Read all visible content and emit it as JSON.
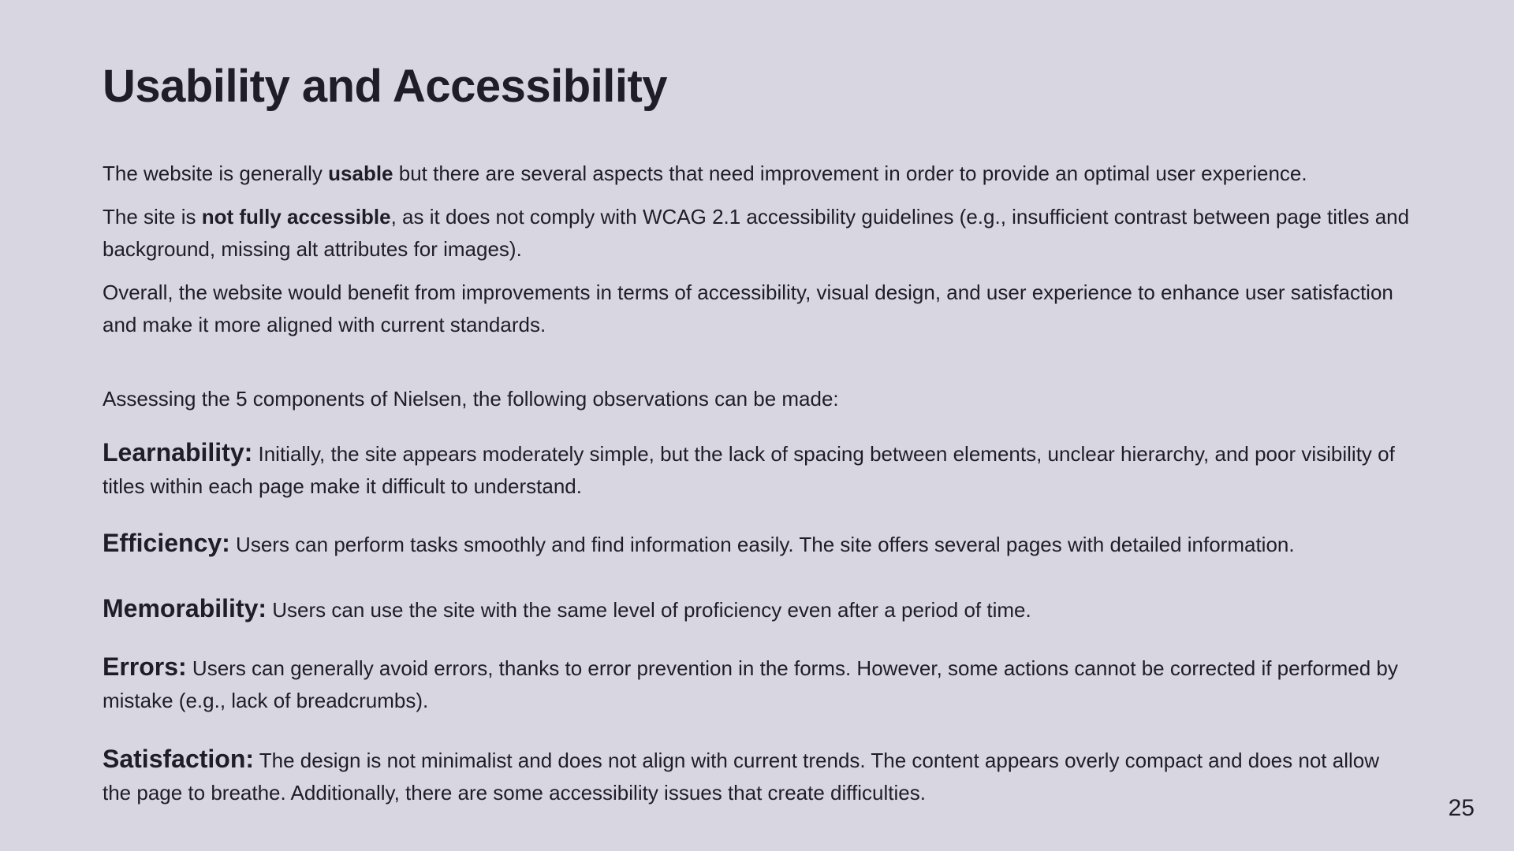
{
  "title": "Usability and Accessibility",
  "intro": {
    "p1_before": "The website is generally ",
    "p1_bold": "usable",
    "p1_after": " but there are several aspects that need improvement in order to provide an optimal user experience.",
    "p2_before": "The site is ",
    "p2_bold": "not fully accessible",
    "p2_after": ", as it does not comply with WCAG 2.1 accessibility guidelines (e.g., insufficient contrast between page titles and background, missing alt attributes for images).",
    "p3": "Overall, the website would benefit from improvements in terms of accessibility, visual design, and user experience to enhance user satisfaction and make it more aligned with current standards."
  },
  "nielsen_intro": "Assessing the 5 components of Nielsen, the following observations can be made:",
  "components": [
    {
      "term": "Learnability:",
      "text": " Initially, the site appears moderately simple, but the lack of spacing between elements, unclear hierarchy, and poor visibility of titles within each page make it difficult to understand."
    },
    {
      "term": "Efficiency:",
      "text": " Users can perform tasks smoothly and find information easily. The site offers several pages with detailed information."
    },
    {
      "term": "Memorability:",
      "text": " Users can use the site with the same level of proficiency even after a period of time."
    },
    {
      "term": "Errors:",
      "text": " Users can generally avoid errors, thanks to error prevention in the forms. However, some actions cannot be corrected if performed by mistake (e.g., lack of breadcrumbs)."
    },
    {
      "term": "Satisfaction:",
      "text": " The design is not minimalist and does not align with current trends. The content appears overly compact and does not allow the page to breathe. Additionally, there are some accessibility issues that create difficulties."
    }
  ],
  "page_number": "25"
}
